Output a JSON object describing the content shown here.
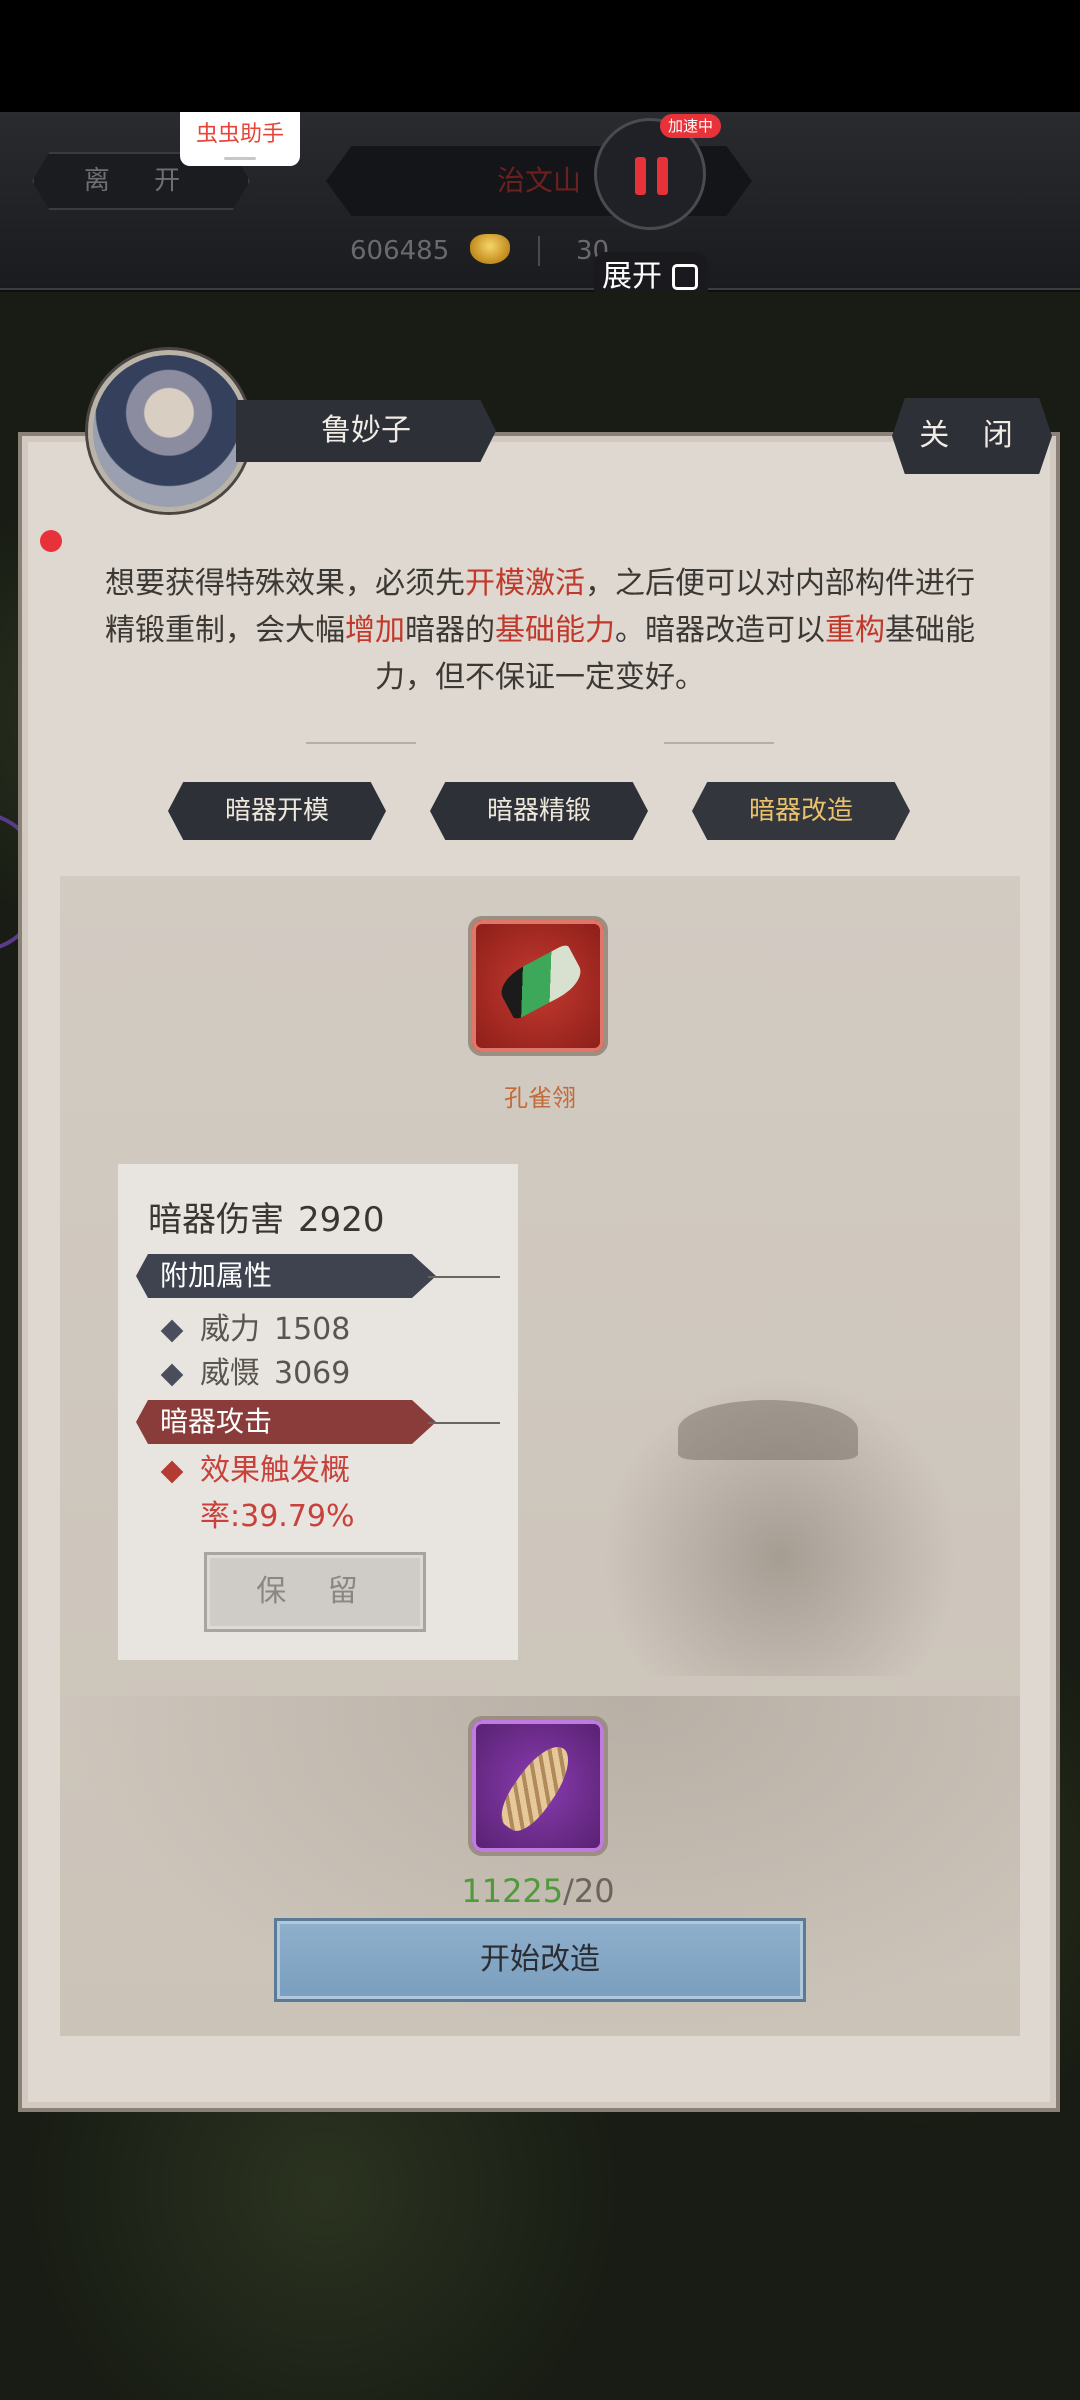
{
  "topbar": {
    "leave_label": "离 开",
    "location": "治文山",
    "gold": "606485",
    "jade": "30",
    "helper_label": "虫虫助手",
    "speed_badge": "加速中",
    "expand_label": "展开"
  },
  "panel": {
    "npc_name": "鲁妙子",
    "close_label": "关 闭",
    "desc": {
      "p1": "想要获得特殊效果，必须先",
      "h1": "开模激活",
      "p2": "，之后便可以对内部构件进行精锻重制，会大幅",
      "h2": "增加",
      "p3": "暗器的",
      "h3": "基础能力",
      "p4": "。暗器改造可以",
      "h4": "重构",
      "p5": "基础能力，但不保证一定变好。"
    },
    "tabs": [
      "暗器开模",
      "暗器精锻",
      "暗器改造"
    ],
    "active_tab": "暗器改造"
  },
  "item": {
    "name": "孔雀翎"
  },
  "stats": {
    "damage_label": "暗器伤害",
    "damage_value": "2920",
    "extra_header": "附加属性",
    "attrs": [
      {
        "name": "威力",
        "value": "1508"
      },
      {
        "name": "威慑",
        "value": "3069"
      }
    ],
    "attack_header": "暗器攻击",
    "effect": "效果触发概率:39.79%",
    "keep_label": "保 留"
  },
  "material": {
    "have": "11225",
    "sep": "/",
    "need": "20"
  },
  "start_label": "开始改造",
  "colors": {
    "highlight": "#c0392b",
    "panel_bg": "#ded8d1",
    "button_dark": "#2e3038",
    "start_button": "#7a9ebe"
  }
}
